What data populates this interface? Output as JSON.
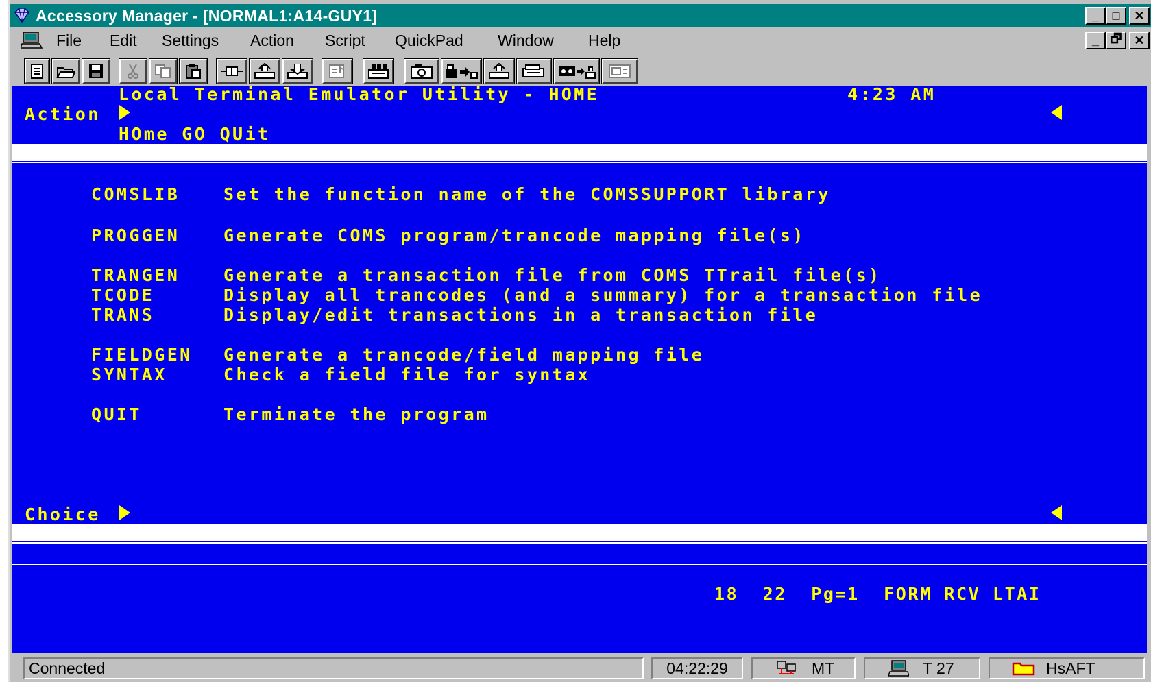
{
  "window": {
    "title": "Accessory Manager - [NORMAL1:A14-GUY1]",
    "min_label": "_",
    "max_label": "□",
    "close_label": "✕",
    "restore_label": "🗗"
  },
  "menu": {
    "file": "File",
    "edit": "Edit",
    "settings": "Settings",
    "action": "Action",
    "script": "Script",
    "quickpad": "QuickPad",
    "window": "Window",
    "help": "Help"
  },
  "toolbar": {
    "icons": [
      "new-document-icon",
      "open-folder-icon",
      "save-disk-icon",
      "cut-icon",
      "copy-icon",
      "paste-icon",
      "connect-plug-icon",
      "send-tray-icon",
      "receive-tray-icon",
      "transfer-icon",
      "keyboard-map-icon",
      "capture-camera-icon",
      "print-tray-icon",
      "print-screen-icon",
      "record-tape-icon",
      "play-tray-icon",
      "panel-icon"
    ]
  },
  "terminal": {
    "header_title": "Local Terminal Emulator Utility - HOME",
    "time": "4:23 AM",
    "action_label": "Action",
    "actions_line": "HOme GO QUit",
    "choice_label": "Choice",
    "menu_items": [
      {
        "code": "COMSLIB",
        "desc": "Set the function name of the COMSSUPPORT library"
      },
      {
        "code": "PROGGEN",
        "desc": "Generate COMS program/trancode mapping file(s)"
      },
      {
        "code": "TRANGEN",
        "desc": "Generate a transaction file from COMS TTrail file(s)"
      },
      {
        "code": "TCODE",
        "desc": "Display all trancodes (and a summary) for a transaction file"
      },
      {
        "code": "TRANS",
        "desc": "Display/edit transactions in a transaction file"
      },
      {
        "code": "FIELDGEN",
        "desc": "Generate a trancode/field mapping file"
      },
      {
        "code": "SYNTAX",
        "desc": "Check a field file for syntax"
      },
      {
        "code": "QUIT",
        "desc": "Terminate the program"
      }
    ],
    "status_line": "18  22  Pg=1  FORM RCV LTAI"
  },
  "statusbar": {
    "status": "Connected",
    "clock": "04:22:29",
    "mode": "MT",
    "terminal": "T 27",
    "flags": "HsAFT"
  },
  "colors": {
    "titlebar": "#008080",
    "terminal_bg": "#0000ee",
    "terminal_text": "#ffff00",
    "chrome": "#c0c0c0"
  }
}
